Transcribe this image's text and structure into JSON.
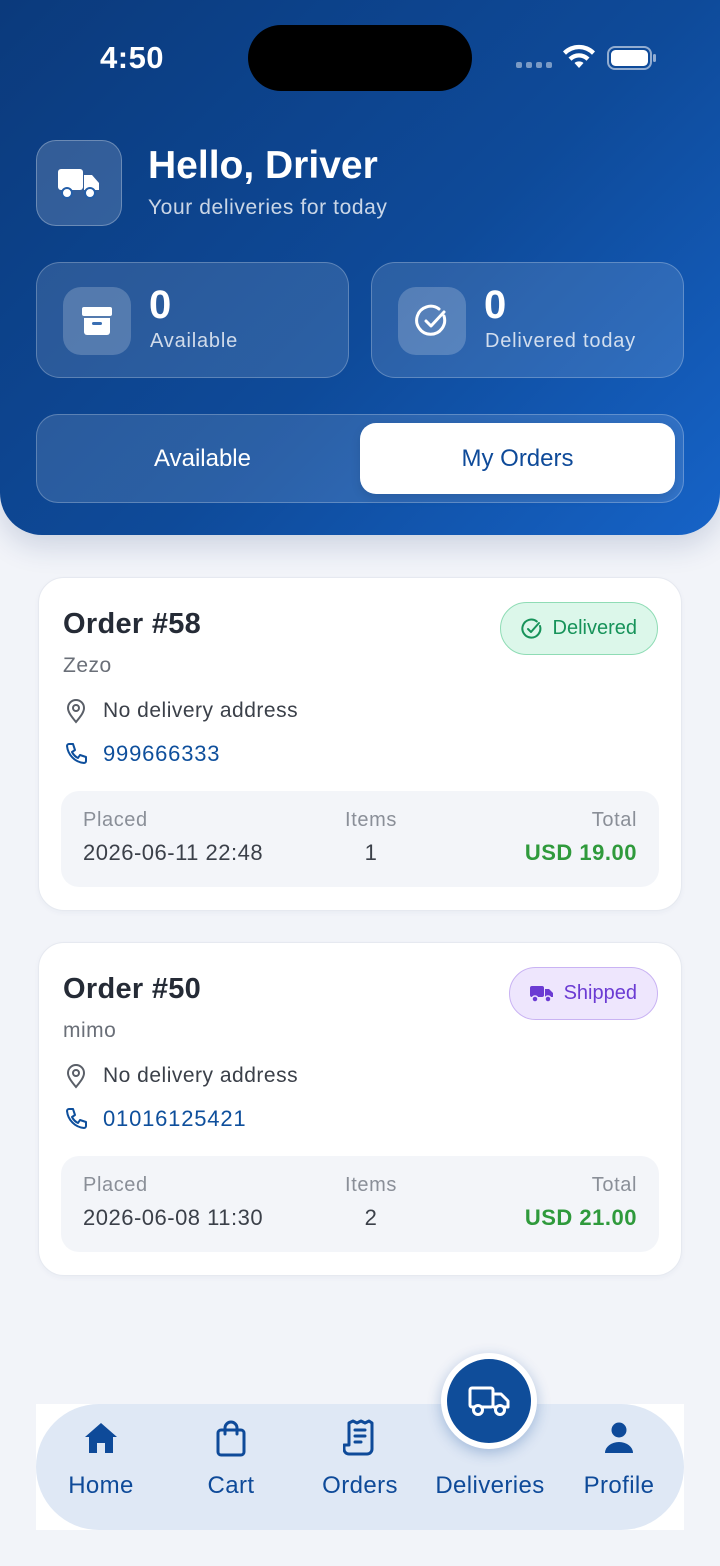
{
  "status_bar": {
    "time": "4:50"
  },
  "header": {
    "greeting": "Hello, Driver",
    "subtitle": "Your deliveries for today"
  },
  "stats": [
    {
      "value": "0",
      "label": "Available",
      "icon": "archive-box-icon"
    },
    {
      "value": "0",
      "label": "Delivered today",
      "icon": "check-circle-icon"
    }
  ],
  "tabs": {
    "available": "Available",
    "my_orders": "My Orders",
    "active": "my_orders"
  },
  "orders": [
    {
      "title": "Order #58",
      "customer": "Zezo",
      "status": "Delivered",
      "address": "No delivery address",
      "phone": "999666333",
      "placed_label": "Placed",
      "placed": "2026-06-11 22:48",
      "items_label": "Items",
      "items": "1",
      "total_label": "Total",
      "total": "USD 19.00"
    },
    {
      "title": "Order #50",
      "customer": "mimo",
      "status": "Shipped",
      "address": "No delivery address",
      "phone": "01016125421",
      "placed_label": "Placed",
      "placed": "2026-06-08 11:30",
      "items_label": "Items",
      "items": "2",
      "total_label": "Total",
      "total": "USD 21.00"
    }
  ],
  "nav": {
    "home": "Home",
    "cart": "Cart",
    "orders": "Orders",
    "deliveries": "Deliveries",
    "profile": "Profile",
    "active": "deliveries"
  },
  "colors": {
    "primary": "#0e4a99",
    "delivered": "#17935a",
    "shipped": "#6b3bd3",
    "total": "#2f9a3c"
  }
}
